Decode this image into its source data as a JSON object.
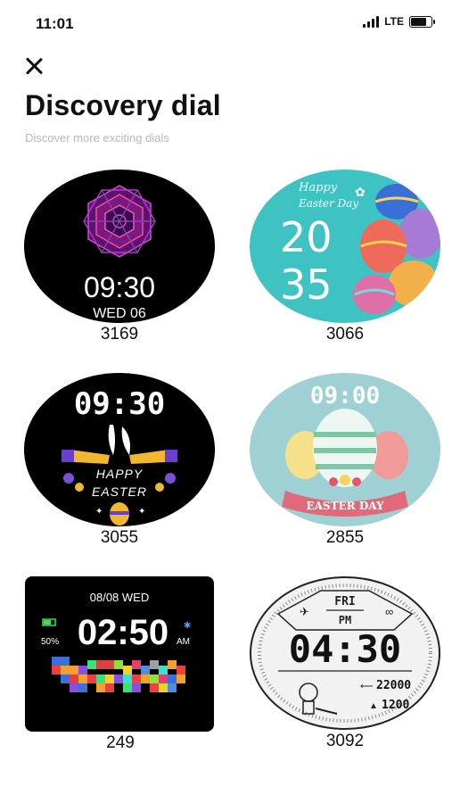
{
  "status": {
    "time": "11:01",
    "network": "LTE",
    "battery_level": 0.7
  },
  "header": {
    "title": "Discovery dial",
    "subtitle": "Discover more exciting dials",
    "close_icon": "close-icon"
  },
  "dials": [
    {
      "id": "3169",
      "time": "09:30",
      "date": "WED 06"
    },
    {
      "id": "3066",
      "greeting_1": "Happy",
      "greeting_2": "Easter Day",
      "hour": "20",
      "minute": "35"
    },
    {
      "id": "3055",
      "time": "09:30",
      "line_1": "HAPPY",
      "line_2": "EASTER"
    },
    {
      "id": "2855",
      "time": "09:00",
      "banner": "EASTER DAY"
    },
    {
      "id": "249",
      "date": "08/08 WED",
      "time": "02:50",
      "battery": "50%",
      "ampm": "AM"
    },
    {
      "id": "3092",
      "day": "FRI",
      "ampm": "PM",
      "time": "04:30",
      "steps": "22000",
      "calories": "1200"
    }
  ],
  "colors": {
    "background": "#ffffff",
    "subtitle": "#b9b9b9",
    "teal": "#3fc3c2",
    "dial_black": "#000000"
  }
}
